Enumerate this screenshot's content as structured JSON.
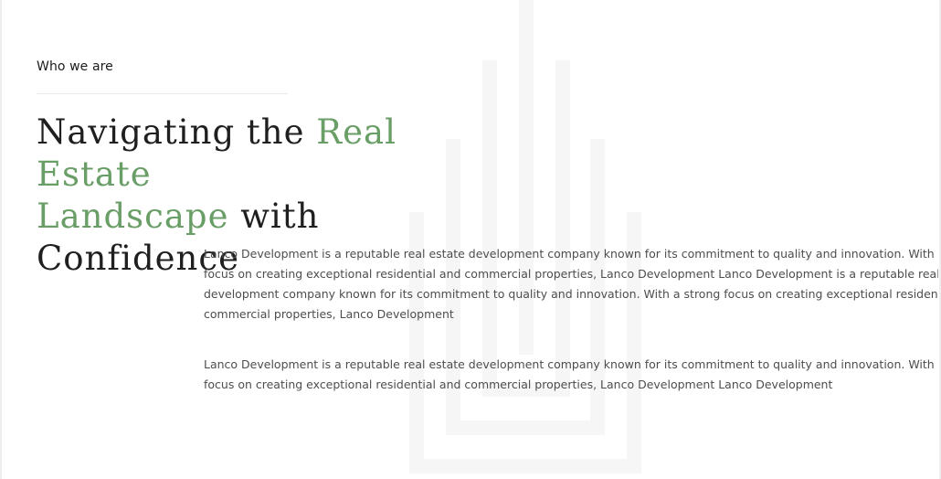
{
  "section": {
    "eyebrow": "Who we are",
    "headline": {
      "part1": "Navigating the ",
      "accent1": "Real Estate",
      "accent2": "Landscape",
      "part2": " with Confidence"
    },
    "paragraph1": [
      "Lanco Development is a reputable real estate development company known for its commitment to quality and innovation. With a strong",
      "focus on creating exceptional residential and commercial properties, Lanco Development Lanco Development is a reputable real estate",
      "development company known for its commitment to quality and innovation. With a strong focus on creating exceptional residential and",
      "commercial properties, Lanco Development"
    ],
    "paragraph2": [
      "Lanco Development is a reputable real estate development company known for its commitment to quality and innovation. With a strong",
      "focus on creating exceptional residential and commercial properties, Lanco Development Lanco Development"
    ]
  },
  "colors": {
    "accent": "#6a9e67",
    "heading": "#1f1f1f",
    "body": "#4d4d4d"
  },
  "icons": {
    "watermark": "building-logo-watermark"
  }
}
